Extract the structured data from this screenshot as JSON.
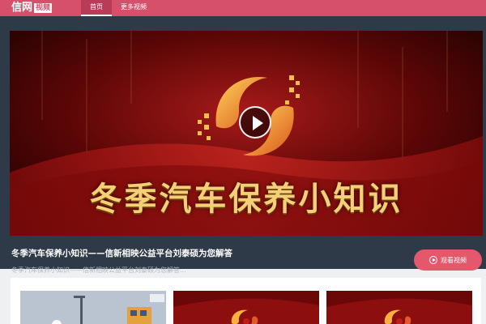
{
  "header": {
    "logo_text": "信网",
    "logo_badge": "视频",
    "tabs": [
      {
        "label": "首页",
        "active": true
      },
      {
        "label": "更多视频",
        "active": false
      }
    ]
  },
  "featured": {
    "video_caption": "冬季汽车保养小知识",
    "title": "冬季汽车保养小知识——信新相映公益平台刘泰硕为您解答",
    "description": "冬季汽车保养小知识——信新相映公益平台刘泰硕为您解答...",
    "watch_label": "观看视频"
  },
  "colors": {
    "nav_bar": "#d6506c",
    "featured_bg": "#2e3a47",
    "watch_button": "#e5576b",
    "caption_gold": "#f3cf77"
  },
  "icons": [
    "play-icon",
    "play-circle-icon",
    "emblem-logo"
  ]
}
